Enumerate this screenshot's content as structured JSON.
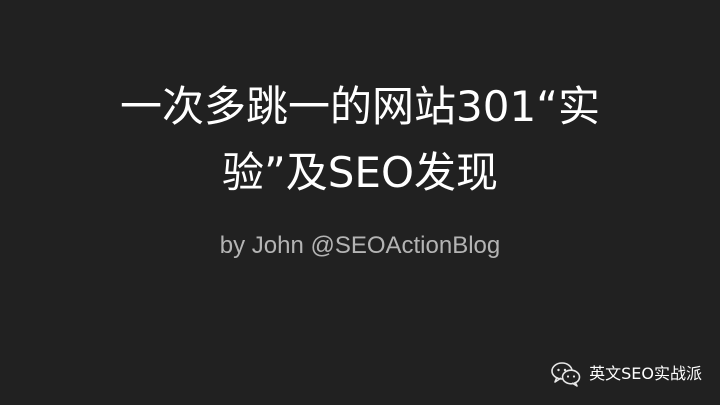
{
  "slide": {
    "title_line_1": "一次多跳一的网站301“实",
    "title_line_2": "验”及SEO发现",
    "subtitle": "by John @SEOActionBlog"
  },
  "watermark": {
    "icon": "wechat-icon",
    "label": "英文SEO实战派"
  },
  "colors": {
    "background": "#212121",
    "title": "#ffffff",
    "subtitle": "#b4b4b4"
  }
}
